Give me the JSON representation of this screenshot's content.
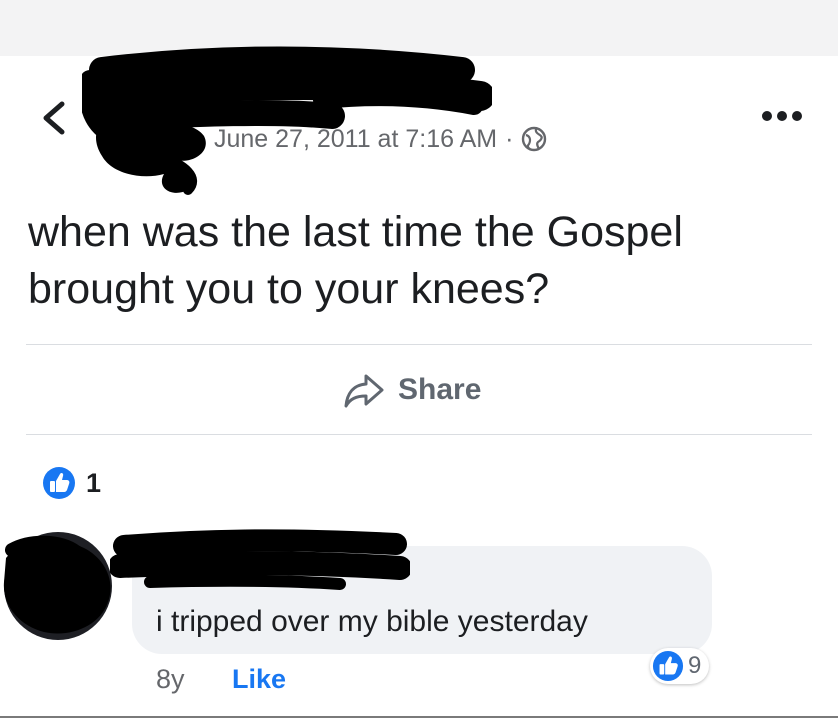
{
  "post": {
    "timestamp": "June 27, 2011 at 7:16 AM",
    "separator": "·",
    "text": "when was the last time the Gospel brought you to your knees?",
    "share_label": "Share",
    "reaction_count": "1"
  },
  "comment": {
    "text": "i tripped over my bible yesterday",
    "age": "8y",
    "like_label": "Like",
    "reaction_count": "9"
  },
  "icons": {
    "back": "chevron-left-icon",
    "more": "more-horizontal-icon",
    "audience": "globe-icon",
    "share": "share-arrow-icon",
    "reaction": "thumbs-up-icon"
  },
  "colors": {
    "accent": "#1877f2",
    "secondary_text": "#65676b",
    "bubble": "#f0f2f5",
    "redaction": "#000000"
  }
}
